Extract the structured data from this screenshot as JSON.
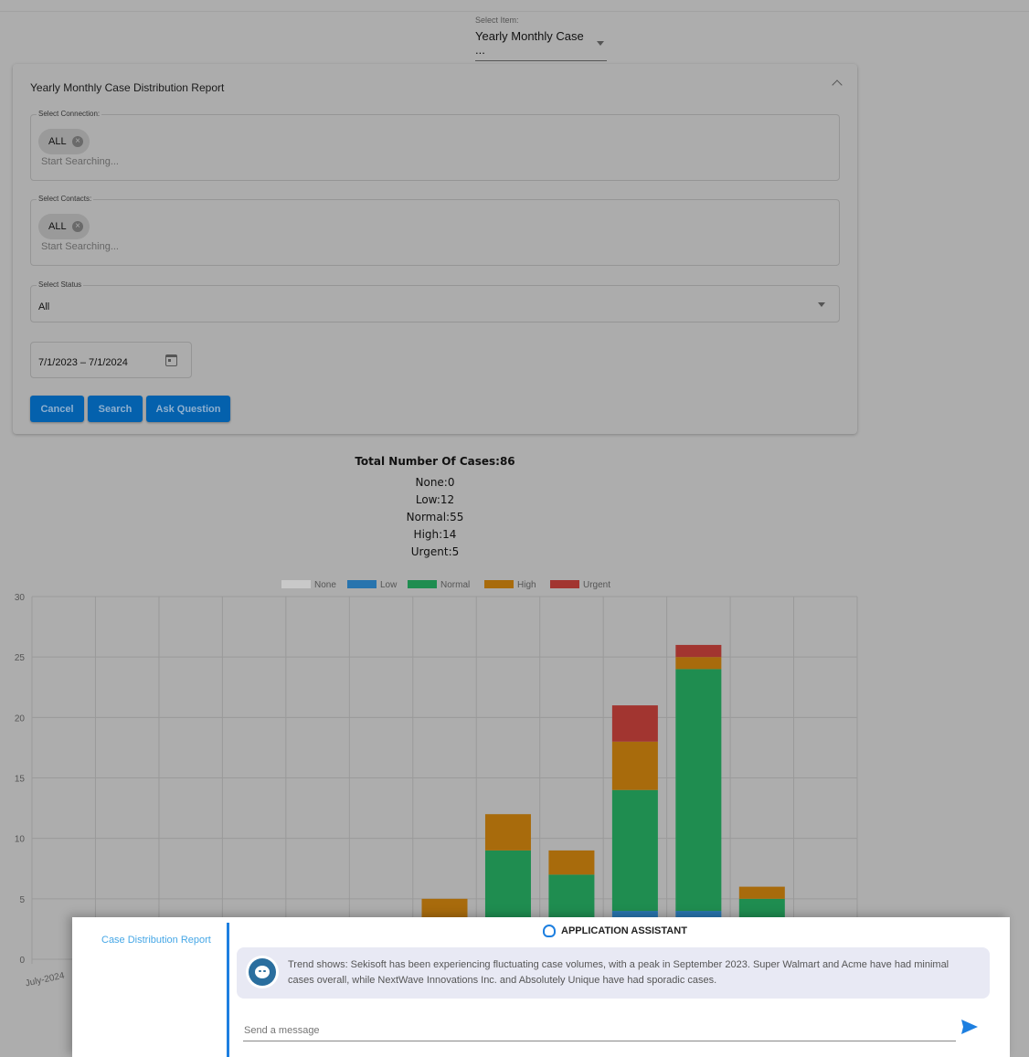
{
  "select_item": {
    "label": "Select Item:",
    "value": "Yearly Monthly Case ..."
  },
  "report": {
    "title": "Yearly Monthly Case Distribution Report",
    "connection": {
      "label": "Select Connection:",
      "chip": "ALL",
      "placeholder": "Start Searching..."
    },
    "contacts": {
      "label": "Select Contacts:",
      "chip": "ALL",
      "placeholder": "Start Searching..."
    },
    "status": {
      "label": "Select Status",
      "value": "All"
    },
    "date_range": "7/1/2023 – 7/1/2024",
    "buttons": {
      "cancel": "Cancel",
      "search": "Search",
      "ask": "Ask Question"
    }
  },
  "summary": {
    "total": "Total Number Of Cases:86",
    "none": "None:0",
    "low": "Low:12",
    "normal": "Normal:55",
    "high": "High:14",
    "urgent": "Urgent:5"
  },
  "chart_data": {
    "type": "bar",
    "stacked": true,
    "title": "",
    "xlabel": "",
    "ylabel": "",
    "ylim": [
      0,
      30
    ],
    "yticks": [
      0,
      5,
      10,
      15,
      20,
      25,
      30
    ],
    "grid": true,
    "legend": "top",
    "categories": [
      "July-2024",
      "",
      "",
      "",
      "",
      "",
      "",
      "",
      "",
      "",
      "",
      "",
      ""
    ],
    "series": [
      {
        "name": "None",
        "color": "#c9c9c9",
        "values": [
          0,
          0,
          0,
          0,
          0,
          0,
          0,
          0,
          0,
          0,
          0,
          0,
          0
        ]
      },
      {
        "name": "Low",
        "color": "#2874ae",
        "values": [
          0,
          0,
          0,
          0,
          0,
          0,
          0,
          0,
          0,
          4,
          4,
          0,
          0
        ]
      },
      {
        "name": "Normal",
        "color": "#1f8d50",
        "values": [
          0,
          0,
          0,
          0,
          0,
          0,
          3,
          9,
          7,
          10,
          20,
          5,
          0
        ]
      },
      {
        "name": "High",
        "color": "#a86b0c",
        "values": [
          0,
          0,
          0,
          0,
          0,
          0,
          2,
          3,
          2,
          4,
          1,
          1,
          0
        ]
      },
      {
        "name": "Urgent",
        "color": "#a23530",
        "values": [
          0,
          0,
          0,
          0,
          0,
          0,
          0,
          0,
          0,
          3,
          1,
          0,
          0
        ]
      }
    ]
  },
  "assistant": {
    "sidebar_link": "Case Distribution Report",
    "title": "APPLICATION ASSISTANT",
    "message": "Trend shows: Sekisoft has been experiencing fluctuating case volumes, with a peak in September 2023. Super Walmart and Acme have had minimal cases overall, while NextWave Innovations Inc. and Absolutely Unique have had sporadic cases.",
    "input_placeholder": "Send a message",
    "send_color": "#1d7fe0"
  }
}
